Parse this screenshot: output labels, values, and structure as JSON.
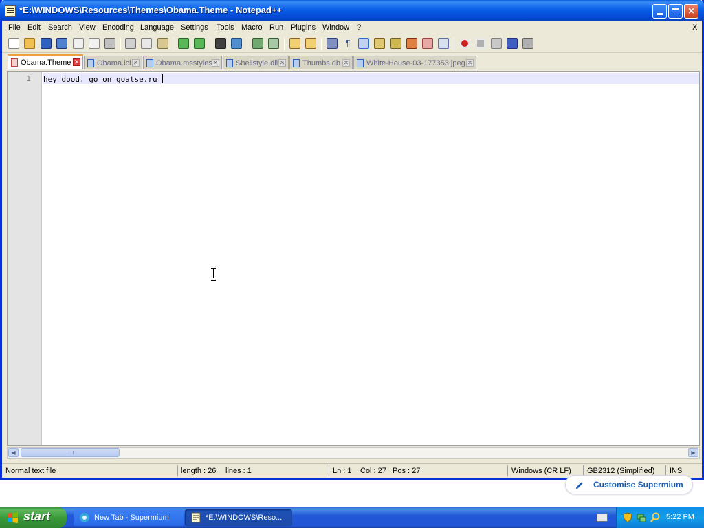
{
  "window": {
    "title": "*E:\\WINDOWS\\Resources\\Themes\\Obama.Theme - Notepad++",
    "minimize_icon": "minimize-icon",
    "maximize_icon": "maximize-icon",
    "close_label": "✕"
  },
  "menu": {
    "items": [
      "File",
      "Edit",
      "Search",
      "View",
      "Encoding",
      "Language",
      "Settings",
      "Tools",
      "Macro",
      "Run",
      "Plugins",
      "Window",
      "?"
    ],
    "close_doc": "X"
  },
  "tabs": [
    {
      "label": "Obama.Theme",
      "active": true
    },
    {
      "label": "Obama.icl"
    },
    {
      "label": "Obama.msstyles"
    },
    {
      "label": "Shellstyle.dll"
    },
    {
      "label": "Thumbs.db"
    },
    {
      "label": "White-House-03-177353.jpeg"
    }
  ],
  "editor": {
    "line_number": "1",
    "line_text": "hey dood. go on goatse.ru "
  },
  "status": {
    "file_type": "Normal text file",
    "length": "length : 26",
    "lines": "lines : 1",
    "ln": "Ln : 1",
    "col": "Col : 27",
    "pos": "Pos : 27",
    "eol": "Windows (CR LF)",
    "encoding": "GB2312 (Simplified)",
    "mode": "INS"
  },
  "browser_hint": {
    "label": "Customise Supermium"
  },
  "taskbar": {
    "start_label": "start",
    "tasks": [
      {
        "label": "New Tab - Supermium"
      },
      {
        "label": "*E:\\WINDOWS\\Reso..."
      }
    ],
    "clock": "5:22 PM"
  },
  "colors": {
    "titlebar": "#0a5fe8",
    "active_tab_marker": "#f0a040",
    "current_line": "#e8e8ff",
    "taskbar": "#2157d7",
    "start_button": "#3a9a3a",
    "link_blue": "#1a5fb4"
  }
}
